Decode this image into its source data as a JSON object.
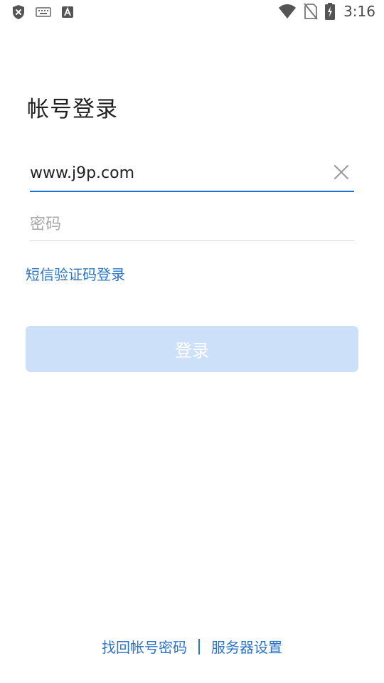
{
  "status_bar": {
    "time": "3:16",
    "icons_left": [
      "shield-x-icon",
      "keyboard-icon",
      "text-a-icon"
    ],
    "icons_right": [
      "wifi-icon",
      "no-sim-icon",
      "battery-charging-icon"
    ]
  },
  "login": {
    "title": "帐号登录",
    "account_value": "www.j9p.com",
    "password_placeholder": "密码",
    "sms_login_label": "短信验证码登录",
    "login_button_label": "登录"
  },
  "footer": {
    "recover_label": "找回帐号密码",
    "server_settings_label": "服务器设置"
  },
  "colors": {
    "accent": "#1a73d9",
    "link": "#2b74c8",
    "button_disabled_bg": "#cde0f9"
  }
}
